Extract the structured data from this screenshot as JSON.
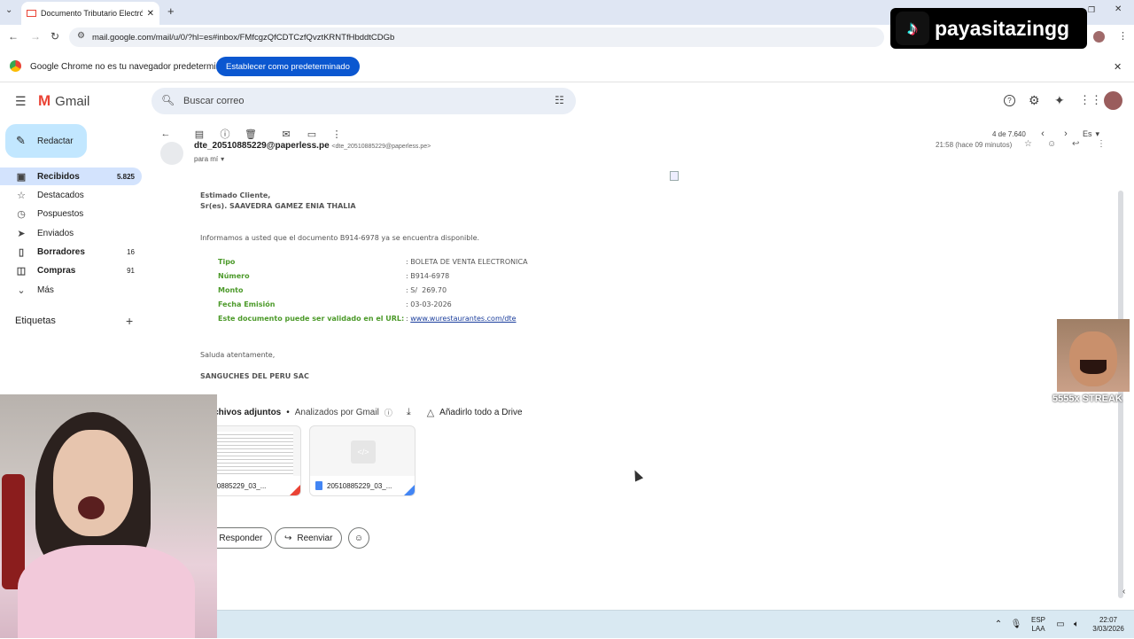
{
  "browser": {
    "tab_title": "Documento Tributario Electrónico",
    "url": "mail.google.com/mail/u/0/?hl=es#inbox/FMfcgzQfCDTCzfQvztKRNTfHbddtCDGb",
    "infobar_text": "Google Chrome no es tu navegador predeterminado",
    "infobar_button": "Establecer como predeterminado"
  },
  "overlay": {
    "tiktok_handle": "payasitazingg",
    "meme_caption": "5555x STREAK"
  },
  "gmail": {
    "logo_text": "Gmail",
    "search_placeholder": "Buscar correo",
    "compose_label": "Redactar",
    "nav": [
      {
        "label": "Recibidos",
        "count": "5.825"
      },
      {
        "label": "Destacados",
        "count": ""
      },
      {
        "label": "Pospuestos",
        "count": ""
      },
      {
        "label": "Enviados",
        "count": ""
      },
      {
        "label": "Borradores",
        "count": "16"
      },
      {
        "label": "Compras",
        "count": "91"
      },
      {
        "label": "Más",
        "count": ""
      }
    ],
    "labels_heading": "Etiquetas",
    "pager": "4 de 7.640",
    "lang": "Es"
  },
  "message": {
    "sender": "dte_20510885229@paperless.pe",
    "sender_email": "<dte_20510885229@paperless.pe>",
    "time": "21:58 (hace 09 minutos)",
    "to": "para mí",
    "greeting": "Estimado Cliente,",
    "recipient": "Sr(es). SAAVEDRA GAMEZ ENIA THALIA",
    "intro": "Informamos a usted que el documento B914-6978 ya se encuentra disponible.",
    "fields": [
      {
        "label": "Tipo",
        "value": "BOLETA DE VENTA ELECTRONICA"
      },
      {
        "label": "Número",
        "value": "B914-6978"
      },
      {
        "label": "Monto",
        "value": "S/  269.70"
      },
      {
        "label": "Fecha Emisión",
        "value": "03-03-2026"
      }
    ],
    "url_label": "Este documento puede ser validado en el URL:",
    "url_value": "www.wurestaurantes.com/dte",
    "closing": "Saluda atentamente,",
    "company": "SANGUCHES DEL PERU SAC"
  },
  "attachments": {
    "heading": "Archivos adjuntos",
    "scanned": "Analizados por Gmail",
    "drive_label": "Añadirlo todo a Drive",
    "files": [
      {
        "name": "20510885229_03_..."
      },
      {
        "name": "20510885229_03_..."
      }
    ]
  },
  "actions": {
    "reply": "Responder",
    "forward": "Reenviar"
  },
  "taskbar": {
    "lang_top": "ESP",
    "lang_bottom": "LAA",
    "time": "22:07",
    "date": "3/03/2026"
  }
}
